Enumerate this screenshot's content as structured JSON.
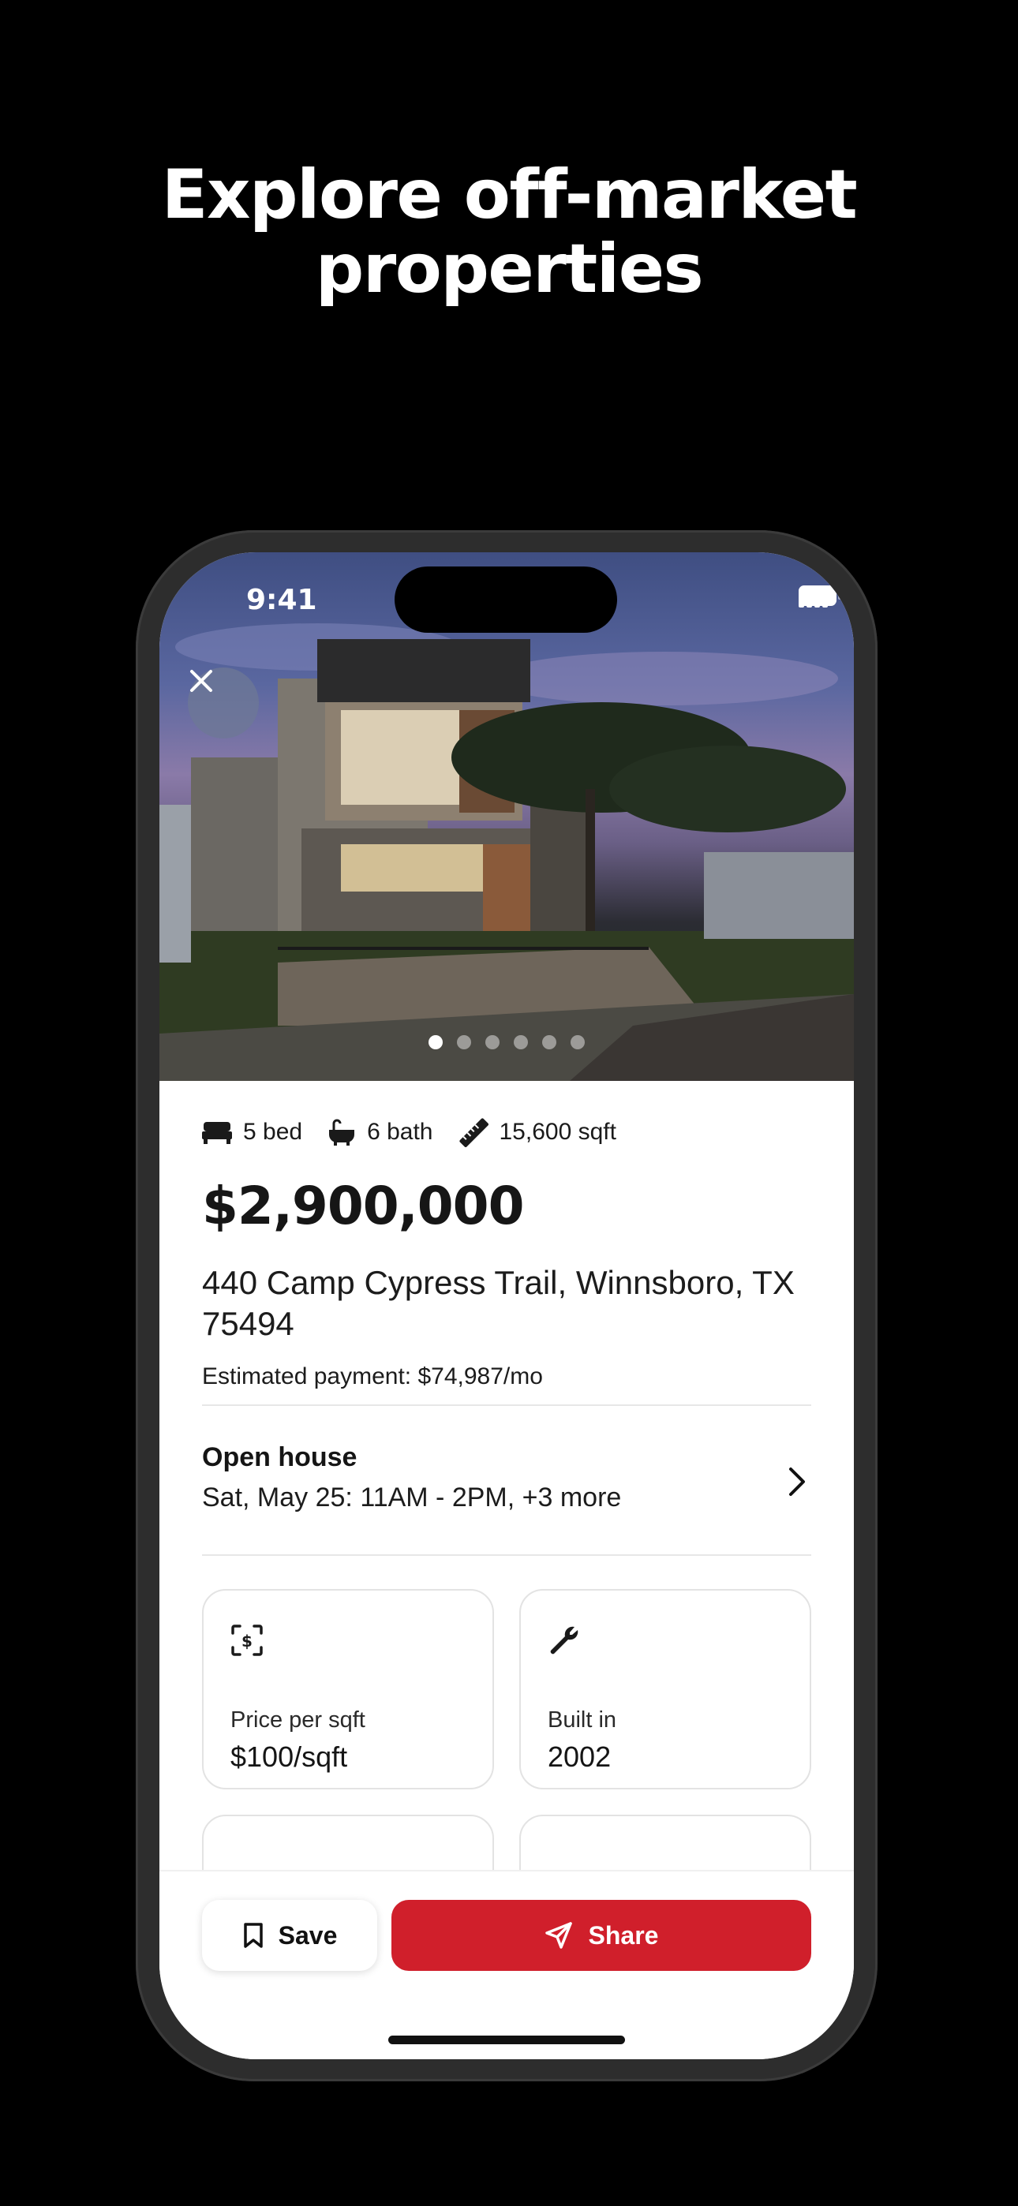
{
  "headline": {
    "line1": "Explore off-market",
    "line2": "properties"
  },
  "status_bar": {
    "time": "9:41"
  },
  "gallery": {
    "photo_count": 6,
    "current_photo": 1
  },
  "listing": {
    "beds": "5 bed",
    "baths": "6 bath",
    "sqft": "15,600 sqft",
    "price": "$2,900,000",
    "address": "440 Camp Cypress Trail, Winnsboro, TX 75494",
    "estimated_payment": "Estimated payment: $74,987/mo"
  },
  "open_house": {
    "title": "Open house",
    "time": "Sat, May 25: 11AM - 2PM, +3 more"
  },
  "cards": [
    {
      "label": "Price per sqft",
      "value": "$100/sqft",
      "icon": "dollar-scan-icon"
    },
    {
      "label": "Built in",
      "value": "2002",
      "icon": "wrench-icon"
    }
  ],
  "actions": {
    "save_label": "Save",
    "share_label": "Share"
  },
  "colors": {
    "accent": "#d01f2b",
    "background": "#000000"
  }
}
